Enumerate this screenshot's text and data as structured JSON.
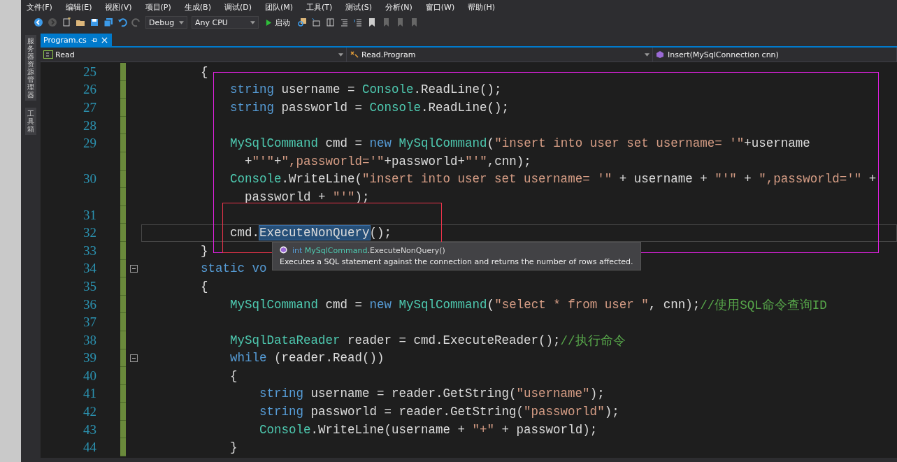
{
  "menu": [
    "文件(F)",
    "编辑(E)",
    "视图(V)",
    "项目(P)",
    "生成(B)",
    "调试(D)",
    "团队(M)",
    "工具(T)",
    "测试(S)",
    "分析(N)",
    "窗口(W)",
    "帮助(H)"
  ],
  "toolbar": {
    "configuration": "Debug",
    "platform": "Any CPU",
    "start": "启动"
  },
  "side_tabs": [
    "服务器资源管理器",
    "工具箱"
  ],
  "tabs": [
    {
      "label": "Program.cs",
      "selected": true
    }
  ],
  "nav": {
    "project": "Read",
    "type": "Read.Program",
    "member": "Insert(MySqlConnection cnn)"
  },
  "code": [
    {
      "number": "25",
      "foldable": false,
      "current": false,
      "tokens": [
        {
          "kind": "plain",
          "text": "        {"
        }
      ]
    },
    {
      "number": "26",
      "foldable": false,
      "current": false,
      "tokens": [
        {
          "kind": "keyword",
          "text": "            string"
        },
        {
          "kind": "plain",
          "text": " username = "
        },
        {
          "kind": "type",
          "text": "Console"
        },
        {
          "kind": "plain",
          "text": ".ReadLine();"
        }
      ]
    },
    {
      "number": "27",
      "foldable": false,
      "current": false,
      "tokens": [
        {
          "kind": "keyword",
          "text": "            string"
        },
        {
          "kind": "plain",
          "text": " passworld = "
        },
        {
          "kind": "type",
          "text": "Console"
        },
        {
          "kind": "plain",
          "text": ".ReadLine();"
        }
      ]
    },
    {
      "number": "28",
      "foldable": false,
      "current": false
    },
    {
      "number": "29",
      "foldable": false,
      "current": false,
      "tokens": [
        {
          "kind": "type",
          "text": "            MySqlCommand"
        },
        {
          "kind": "plain",
          "text": " cmd = "
        },
        {
          "kind": "keyword",
          "text": "new"
        },
        {
          "kind": "type",
          "text": " MySqlCommand"
        },
        {
          "kind": "plain",
          "text": "("
        },
        {
          "kind": "string",
          "text": "\"insert into user set username= '\""
        },
        {
          "kind": "plain",
          "text": "+username"
        }
      ]
    },
    {
      "foldable": false,
      "current": false,
      "tokens": [
        {
          "kind": "plain",
          "text": "              +"
        },
        {
          "kind": "string",
          "text": "\"'\""
        },
        {
          "kind": "plain",
          "text": "+"
        },
        {
          "kind": "string",
          "text": "\",passworld='\""
        },
        {
          "kind": "plain",
          "text": "+passworld+"
        },
        {
          "kind": "string",
          "text": "\"'\""
        },
        {
          "kind": "plain",
          "text": ",cnn);"
        }
      ]
    },
    {
      "number": "30",
      "foldable": false,
      "current": false,
      "tokens": [
        {
          "kind": "type",
          "text": "            Console"
        },
        {
          "kind": "plain",
          "text": ".WriteLine("
        },
        {
          "kind": "string",
          "text": "\"insert into user set username= '\""
        },
        {
          "kind": "plain",
          "text": " + username + "
        },
        {
          "kind": "string",
          "text": "\"'\""
        },
        {
          "kind": "plain",
          "text": " + "
        },
        {
          "kind": "string",
          "text": "\",passworld='\""
        },
        {
          "kind": "plain",
          "text": " +"
        }
      ]
    },
    {
      "foldable": false,
      "current": false,
      "tokens": [
        {
          "kind": "plain",
          "text": "              passworld + "
        },
        {
          "kind": "string",
          "text": "\"'\""
        },
        {
          "kind": "plain",
          "text": ");"
        }
      ]
    },
    {
      "number": "31",
      "foldable": false,
      "current": false
    },
    {
      "number": "32",
      "foldable": false,
      "current": true,
      "tokens": [
        {
          "kind": "plain",
          "text": "            cmd."
        },
        {
          "kind": "selected",
          "text": "ExecuteNonQuery"
        },
        {
          "kind": "plain",
          "text": "();"
        }
      ]
    },
    {
      "number": "33",
      "foldable": false,
      "current": false,
      "tokens": [
        {
          "kind": "plain",
          "text": "        }"
        }
      ]
    },
    {
      "number": "34",
      "foldable": true,
      "current": false,
      "tokens": [
        {
          "kind": "keyword",
          "text": "        static vo"
        }
      ]
    },
    {
      "number": "35",
      "foldable": false,
      "current": false,
      "tokens": [
        {
          "kind": "plain",
          "text": "        {"
        }
      ]
    },
    {
      "number": "36",
      "foldable": false,
      "current": false,
      "tokens": [
        {
          "kind": "type",
          "text": "            MySqlCommand"
        },
        {
          "kind": "plain",
          "text": " cmd = "
        },
        {
          "kind": "keyword",
          "text": "new"
        },
        {
          "kind": "type",
          "text": " MySqlCommand"
        },
        {
          "kind": "plain",
          "text": "("
        },
        {
          "kind": "string",
          "text": "\"select * from user \""
        },
        {
          "kind": "plain",
          "text": ", cnn);"
        },
        {
          "kind": "comment",
          "text": "//使用SQL命令查询ID"
        }
      ]
    },
    {
      "number": "37",
      "foldable": false,
      "current": false
    },
    {
      "number": "38",
      "foldable": false,
      "current": false,
      "tokens": [
        {
          "kind": "type",
          "text": "            MySqlDataReader"
        },
        {
          "kind": "plain",
          "text": " reader = cmd.ExecuteReader();"
        },
        {
          "kind": "comment",
          "text": "//执行命令"
        }
      ]
    },
    {
      "number": "39",
      "foldable": true,
      "current": false,
      "tokens": [
        {
          "kind": "keyword",
          "text": "            while"
        },
        {
          "kind": "plain",
          "text": " (reader.Read())"
        }
      ]
    },
    {
      "number": "40",
      "foldable": false,
      "current": false,
      "tokens": [
        {
          "kind": "plain",
          "text": "            {"
        }
      ]
    },
    {
      "number": "41",
      "foldable": false,
      "current": false,
      "tokens": [
        {
          "kind": "keyword",
          "text": "                string"
        },
        {
          "kind": "plain",
          "text": " username = reader.GetString("
        },
        {
          "kind": "string",
          "text": "\"username\""
        },
        {
          "kind": "plain",
          "text": ");"
        }
      ]
    },
    {
      "number": "42",
      "foldable": false,
      "current": false,
      "tokens": [
        {
          "kind": "keyword",
          "text": "                string"
        },
        {
          "kind": "plain",
          "text": " passworld = reader.GetString("
        },
        {
          "kind": "string",
          "text": "\"passworld\""
        },
        {
          "kind": "plain",
          "text": ");"
        }
      ]
    },
    {
      "number": "43",
      "foldable": false,
      "current": false,
      "tokens": [
        {
          "kind": "type",
          "text": "                Console"
        },
        {
          "kind": "plain",
          "text": ".WriteLine(username + "
        },
        {
          "kind": "string",
          "text": "\"+\""
        },
        {
          "kind": "plain",
          "text": " + passworld);"
        }
      ]
    },
    {
      "number": "44",
      "foldable": false,
      "current": false,
      "tokens": [
        {
          "kind": "plain",
          "text": "            }"
        }
      ]
    }
  ],
  "tooltip": {
    "signature": [
      {
        "kind": "keyword",
        "text": "int "
      },
      {
        "kind": "type",
        "text": "MySqlCommand"
      },
      {
        "kind": "plain",
        "text": ".ExecuteNonQuery()"
      }
    ],
    "description": "Executes a SQL statement against the connection and returns the number of rows affected."
  }
}
